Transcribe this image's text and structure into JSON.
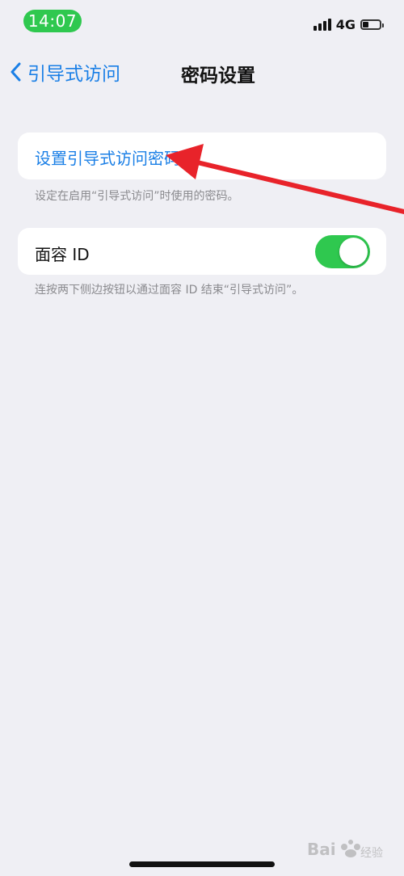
{
  "status_bar": {
    "time": "14:07",
    "network": "4G",
    "battery_level": 0.35,
    "signal_bars": 4,
    "accent_color": "#2fc84f"
  },
  "nav": {
    "back_label": "引导式访问",
    "title": "密码设置",
    "back_icon": "chevron-left-icon",
    "accent_color": "#1a7fe6"
  },
  "passcode_group": {
    "link_label": "设置引导式访问密码",
    "footnote": "设定在启用“引导式访问”时使用的密码。"
  },
  "face_id_group": {
    "label": "面容 ID",
    "toggle_on": true,
    "footnote": "连按两下侧边按钮以通过面容 ID 结束“引导式访问”。"
  },
  "annotation": {
    "type": "arrow",
    "color": "#e8232a",
    "target": "passcode-link"
  }
}
